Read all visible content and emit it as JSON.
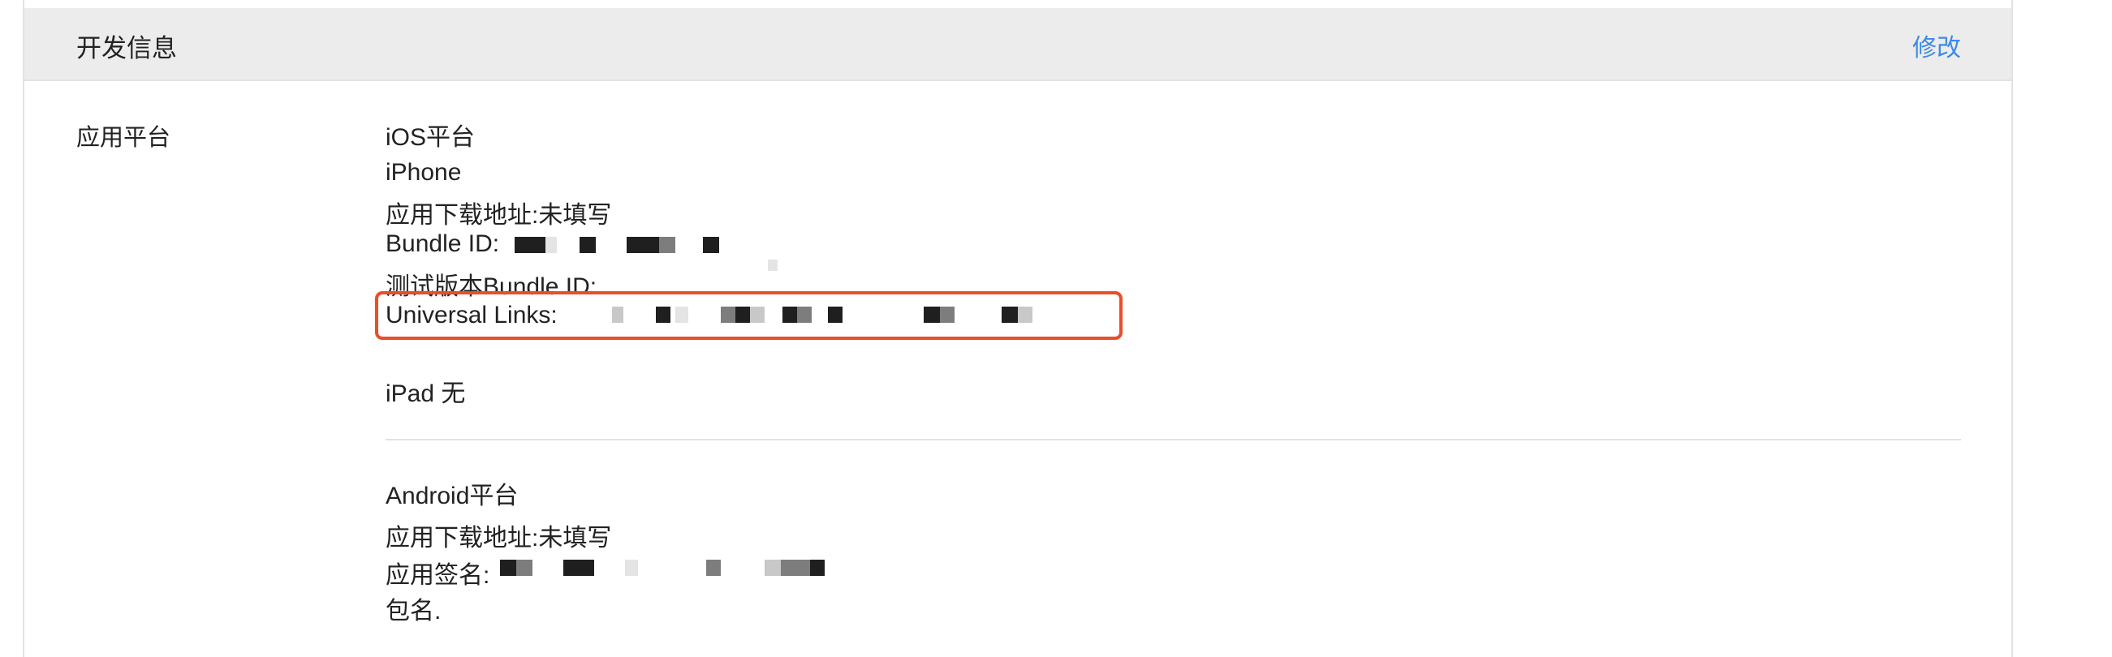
{
  "header": {
    "title": "开发信息",
    "edit_label": "修改"
  },
  "section": {
    "label": "应用平台"
  },
  "ios": {
    "platform_title": "iOS平台",
    "iphone": {
      "device_label": "iPhone",
      "download_url_label": "应用下载地址:",
      "download_url_value": "未填写",
      "bundle_id_label": "Bundle ID:",
      "test_bundle_id_label": "测试版本Bundle ID:",
      "universal_links_label": "Universal Links:"
    },
    "ipad": {
      "label": "iPad",
      "value": "无"
    }
  },
  "android": {
    "platform_title": "Android平台",
    "download_url_label": "应用下载地址:",
    "download_url_value": "未填写",
    "signature_label": "应用签名:",
    "package_label": "包名."
  },
  "colors": {
    "accent": "#3d8ae5",
    "highlight": "#e84e2a",
    "header_bg": "#ececec"
  }
}
